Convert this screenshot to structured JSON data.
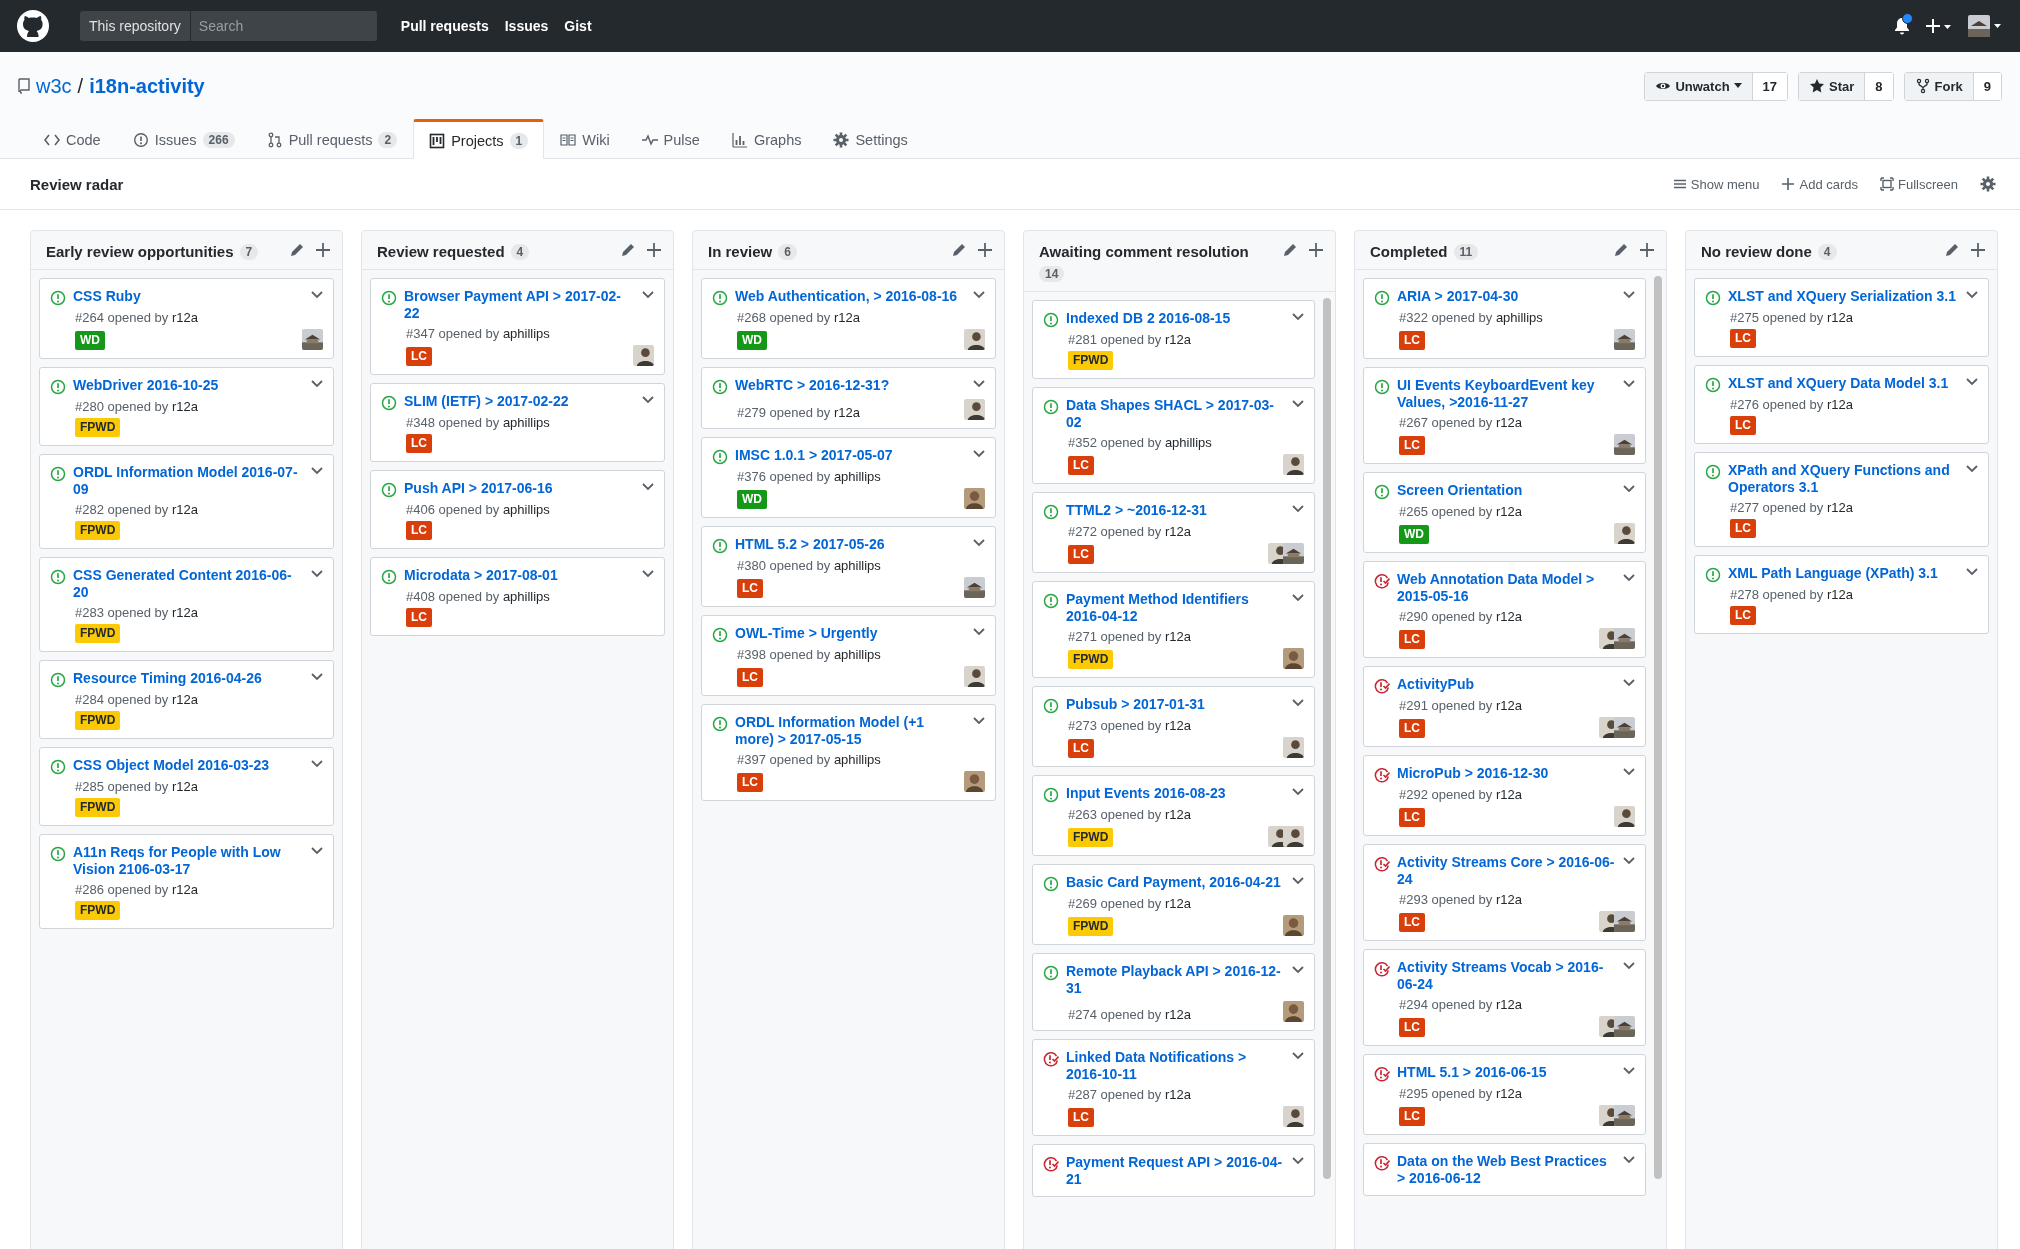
{
  "top_bar": {
    "scope": "This repository",
    "search": {
      "placeholder": "Search"
    },
    "links": [
      "Pull requests",
      "Issues",
      "Gist"
    ],
    "notification_unread": true
  },
  "repo": {
    "owner": "w3c",
    "separator": "/",
    "name": "i18n-activity",
    "actions": [
      {
        "label": "Unwatch",
        "kind": "watch",
        "count": "17"
      },
      {
        "label": "Star",
        "kind": "star",
        "count": "8"
      },
      {
        "label": "Fork",
        "kind": "fork",
        "count": "9"
      }
    ]
  },
  "tabs": [
    {
      "label": "Code",
      "kind": "code",
      "selected": false
    },
    {
      "label": "Issues",
      "kind": "issues",
      "count": "266",
      "selected": false
    },
    {
      "label": "Pull requests",
      "kind": "pull",
      "count": "2",
      "selected": false
    },
    {
      "label": "Projects",
      "kind": "projects",
      "count": "1",
      "selected": true
    },
    {
      "label": "Wiki",
      "kind": "wiki",
      "selected": false
    },
    {
      "label": "Pulse",
      "kind": "pulse",
      "selected": false
    },
    {
      "label": "Graphs",
      "kind": "graphs",
      "selected": false
    },
    {
      "label": "Settings",
      "kind": "settings",
      "selected": false
    }
  ],
  "project": {
    "title": "Review radar",
    "actions": [
      {
        "label": "Show menu",
        "kind": "menu"
      },
      {
        "label": "Add cards",
        "kind": "add"
      },
      {
        "label": "Fullscreen",
        "kind": "fullscreen"
      }
    ]
  },
  "columns": [
    {
      "title": "Early review opportunities",
      "count": "7",
      "scrollable": false,
      "cards": [
        {
          "closed": false,
          "title": "CSS Ruby",
          "number": "#264",
          "verb": "opened by",
          "author": "r12a",
          "label": {
            "text": "WD",
            "color": "#159818"
          },
          "avatars": [
            {
              "kind": "building"
            }
          ]
        },
        {
          "closed": false,
          "title": "WebDriver 2016-10-25",
          "number": "#280",
          "verb": "opened by",
          "author": "r12a",
          "label": {
            "text": "FPWD",
            "color": "#fbca04"
          }
        },
        {
          "closed": false,
          "title": "ORDL Information Model 2016-07-09",
          "number": "#282",
          "verb": "opened by",
          "author": "r12a",
          "label": {
            "text": "FPWD",
            "color": "#fbca04"
          }
        },
        {
          "closed": false,
          "title": "CSS Generated Content 2016-06-20",
          "number": "#283",
          "verb": "opened by",
          "author": "r12a",
          "label": {
            "text": "FPWD",
            "color": "#fbca04"
          }
        },
        {
          "closed": false,
          "title": "Resource Timing 2016-04-26",
          "number": "#284",
          "verb": "opened by",
          "author": "r12a",
          "label": {
            "text": "FPWD",
            "color": "#fbca04"
          }
        },
        {
          "closed": false,
          "title": "CSS Object Model 2016-03-23",
          "number": "#285",
          "verb": "opened by",
          "author": "r12a",
          "label": {
            "text": "FPWD",
            "color": "#fbca04"
          }
        },
        {
          "closed": false,
          "title": "A11n Reqs for People with Low Vision 2106-03-17",
          "number": "#286",
          "verb": "opened by",
          "author": "r12a",
          "label": {
            "text": "FPWD",
            "color": "#fbca04"
          }
        }
      ]
    },
    {
      "title": "Review requested",
      "count": "4",
      "scrollable": false,
      "cards": [
        {
          "closed": false,
          "title": "Browser Payment API > 2017-02-22",
          "number": "#347",
          "verb": "opened by",
          "author": "aphillips",
          "label": {
            "text": "LC",
            "color": "#d93f0b"
          },
          "avatars": [
            {
              "kind": "person"
            }
          ]
        },
        {
          "closed": false,
          "title": "SLIM (IETF) > 2017-02-22",
          "number": "#348",
          "verb": "opened by",
          "author": "aphillips",
          "label": {
            "text": "LC",
            "color": "#d93f0b"
          }
        },
        {
          "closed": false,
          "title": "Push API > 2017-06-16",
          "number": "#406",
          "verb": "opened by",
          "author": "aphillips",
          "label": {
            "text": "LC",
            "color": "#d93f0b"
          }
        },
        {
          "closed": false,
          "title": "Microdata > 2017-08-01",
          "number": "#408",
          "verb": "opened by",
          "author": "aphillips",
          "label": {
            "text": "LC",
            "color": "#d93f0b"
          }
        }
      ]
    },
    {
      "title": "In review",
      "count": "6",
      "scrollable": false,
      "cards": [
        {
          "closed": false,
          "title": "Web Authentication, > 2016-08-16",
          "number": "#268",
          "verb": "opened by",
          "author": "r12a",
          "label": {
            "text": "WD",
            "color": "#159818"
          },
          "avatars": [
            {
              "kind": "person"
            }
          ]
        },
        {
          "closed": false,
          "title": "WebRTC > 2016-12-31?",
          "number": "#279",
          "verb": "opened by",
          "author": "r12a",
          "avatars": [
            {
              "kind": "person"
            }
          ]
        },
        {
          "closed": false,
          "title": "IMSC 1.0.1 > 2017-05-07",
          "number": "#376",
          "verb": "opened by",
          "author": "aphillips",
          "label": {
            "text": "WD",
            "color": "#159818"
          },
          "avatars": [
            {
              "kind": "portrait"
            }
          ]
        },
        {
          "closed": false,
          "title": "HTML 5.2 > 2017-05-26",
          "number": "#380",
          "verb": "opened by",
          "author": "aphillips",
          "label": {
            "text": "LC",
            "color": "#d93f0b"
          },
          "avatars": [
            {
              "kind": "building"
            }
          ]
        },
        {
          "closed": false,
          "title": "OWL-Time > Urgently",
          "number": "#398",
          "verb": "opened by",
          "author": "aphillips",
          "label": {
            "text": "LC",
            "color": "#d93f0b"
          },
          "avatars": [
            {
              "kind": "person"
            }
          ]
        },
        {
          "closed": false,
          "title": "ORDL Information Model (+1 more) > 2017-05-15",
          "number": "#397",
          "verb": "opened by",
          "author": "aphillips",
          "label": {
            "text": "LC",
            "color": "#d93f0b"
          },
          "avatars": [
            {
              "kind": "portrait"
            }
          ]
        }
      ]
    },
    {
      "title": "Awaiting comment resolution",
      "count": "14",
      "scrollable": true,
      "cards": [
        {
          "closed": false,
          "title": "Indexed DB 2 2016-08-15",
          "number": "#281",
          "verb": "opened by",
          "author": "r12a",
          "label": {
            "text": "FPWD",
            "color": "#fbca04"
          }
        },
        {
          "closed": false,
          "title": "Data Shapes SHACL > 2017-03-02",
          "number": "#352",
          "verb": "opened by",
          "author": "aphillips",
          "label": {
            "text": "LC",
            "color": "#d93f0b"
          },
          "avatars": [
            {
              "kind": "person"
            }
          ]
        },
        {
          "closed": false,
          "title": "TTML2 > ~2016-12-31",
          "number": "#272",
          "verb": "opened by",
          "author": "r12a",
          "label": {
            "text": "LC",
            "color": "#d93f0b"
          },
          "avatars": [
            {
              "kind": "person"
            },
            {
              "kind": "building"
            }
          ]
        },
        {
          "closed": false,
          "title": "Payment Method Identifiers 2016-04-12",
          "number": "#271",
          "verb": "opened by",
          "author": "r12a",
          "label": {
            "text": "FPWD",
            "color": "#fbca04"
          },
          "avatars": [
            {
              "kind": "portrait"
            }
          ]
        },
        {
          "closed": false,
          "title": "Pubsub > 2017-01-31",
          "number": "#273",
          "verb": "opened by",
          "author": "r12a",
          "label": {
            "text": "LC",
            "color": "#d93f0b"
          },
          "avatars": [
            {
              "kind": "person"
            }
          ]
        },
        {
          "closed": false,
          "title": "Input Events 2016-08-23",
          "number": "#263",
          "verb": "opened by",
          "author": "r12a",
          "label": {
            "text": "FPWD",
            "color": "#fbca04"
          },
          "avatars": [
            {
              "kind": "person"
            },
            {
              "kind": "person"
            }
          ]
        },
        {
          "closed": false,
          "title": "Basic Card Payment, 2016-04-21",
          "number": "#269",
          "verb": "opened by",
          "author": "r12a",
          "label": {
            "text": "FPWD",
            "color": "#fbca04"
          },
          "avatars": [
            {
              "kind": "portrait"
            }
          ]
        },
        {
          "closed": false,
          "title": "Remote Playback API > 2016-12-31",
          "number": "#274",
          "verb": "opened by",
          "author": "r12a",
          "avatars": [
            {
              "kind": "portrait"
            }
          ]
        },
        {
          "closed": true,
          "title": "Linked Data Notifications > 2016-10-11",
          "number": "#287",
          "verb": "opened by",
          "author": "r12a",
          "label": {
            "text": "LC",
            "color": "#d93f0b"
          },
          "avatars": [
            {
              "kind": "person"
            }
          ]
        },
        {
          "closed": true,
          "title": "Payment Request API > 2016-04-21"
        }
      ]
    },
    {
      "title": "Completed",
      "count": "11",
      "scrollable": true,
      "cards": [
        {
          "closed": false,
          "title": "ARIA > 2017-04-30",
          "number": "#322",
          "verb": "opened by",
          "author": "aphillips",
          "label": {
            "text": "LC",
            "color": "#d93f0b"
          },
          "avatars": [
            {
              "kind": "building"
            }
          ]
        },
        {
          "closed": false,
          "title": "UI Events KeyboardEvent key Values, >2016-11-27",
          "number": "#267",
          "verb": "opened by",
          "author": "r12a",
          "label": {
            "text": "LC",
            "color": "#d93f0b"
          },
          "avatars": [
            {
              "kind": "building"
            }
          ]
        },
        {
          "closed": false,
          "title": "Screen Orientation",
          "number": "#265",
          "verb": "opened by",
          "author": "r12a",
          "label": {
            "text": "WD",
            "color": "#159818"
          },
          "avatars": [
            {
              "kind": "person"
            }
          ]
        },
        {
          "closed": true,
          "title": "Web Annotation Data Model > 2015-05-16",
          "number": "#290",
          "verb": "opened by",
          "author": "r12a",
          "label": {
            "text": "LC",
            "color": "#d93f0b"
          },
          "avatars": [
            {
              "kind": "person"
            },
            {
              "kind": "building"
            }
          ]
        },
        {
          "closed": true,
          "title": "ActivityPub",
          "number": "#291",
          "verb": "opened by",
          "author": "r12a",
          "label": {
            "text": "LC",
            "color": "#d93f0b"
          },
          "avatars": [
            {
              "kind": "person"
            },
            {
              "kind": "building"
            }
          ]
        },
        {
          "closed": true,
          "title": "MicroPub > 2016-12-30",
          "number": "#292",
          "verb": "opened by",
          "author": "r12a",
          "label": {
            "text": "LC",
            "color": "#d93f0b"
          },
          "avatars": [
            {
              "kind": "person"
            }
          ]
        },
        {
          "closed": true,
          "title": "Activity Streams Core > 2016-06-24",
          "number": "#293",
          "verb": "opened by",
          "author": "r12a",
          "label": {
            "text": "LC",
            "color": "#d93f0b"
          },
          "avatars": [
            {
              "kind": "person"
            },
            {
              "kind": "building"
            }
          ]
        },
        {
          "closed": true,
          "title": "Activity Streams Vocab > 2016-06-24",
          "number": "#294",
          "verb": "opened by",
          "author": "r12a",
          "label": {
            "text": "LC",
            "color": "#d93f0b"
          },
          "avatars": [
            {
              "kind": "person"
            },
            {
              "kind": "building"
            }
          ]
        },
        {
          "closed": true,
          "title": "HTML 5.1 > 2016-06-15",
          "number": "#295",
          "verb": "opened by",
          "author": "r12a",
          "label": {
            "text": "LC",
            "color": "#d93f0b"
          },
          "avatars": [
            {
              "kind": "person"
            },
            {
              "kind": "building"
            }
          ]
        },
        {
          "closed": true,
          "title": "Data on the Web Best Practices > 2016-06-12"
        }
      ]
    },
    {
      "title": "No review done",
      "count": "4",
      "scrollable": false,
      "cards": [
        {
          "closed": false,
          "title": "XLST and XQuery Serialization 3.1",
          "number": "#275",
          "verb": "opened by",
          "author": "r12a",
          "label": {
            "text": "LC",
            "color": "#d93f0b"
          }
        },
        {
          "closed": false,
          "title": "XLST and XQuery Data Model 3.1",
          "number": "#276",
          "verb": "opened by",
          "author": "r12a",
          "label": {
            "text": "LC",
            "color": "#d93f0b"
          }
        },
        {
          "closed": false,
          "title": "XPath and XQuery Functions and Operators 3.1",
          "number": "#277",
          "verb": "opened by",
          "author": "r12a",
          "label": {
            "text": "LC",
            "color": "#d93f0b"
          }
        },
        {
          "closed": false,
          "title": "XML Path Language (XPath) 3.1",
          "number": "#278",
          "verb": "opened by",
          "author": "r12a",
          "label": {
            "text": "LC",
            "color": "#d93f0b"
          }
        }
      ]
    }
  ]
}
